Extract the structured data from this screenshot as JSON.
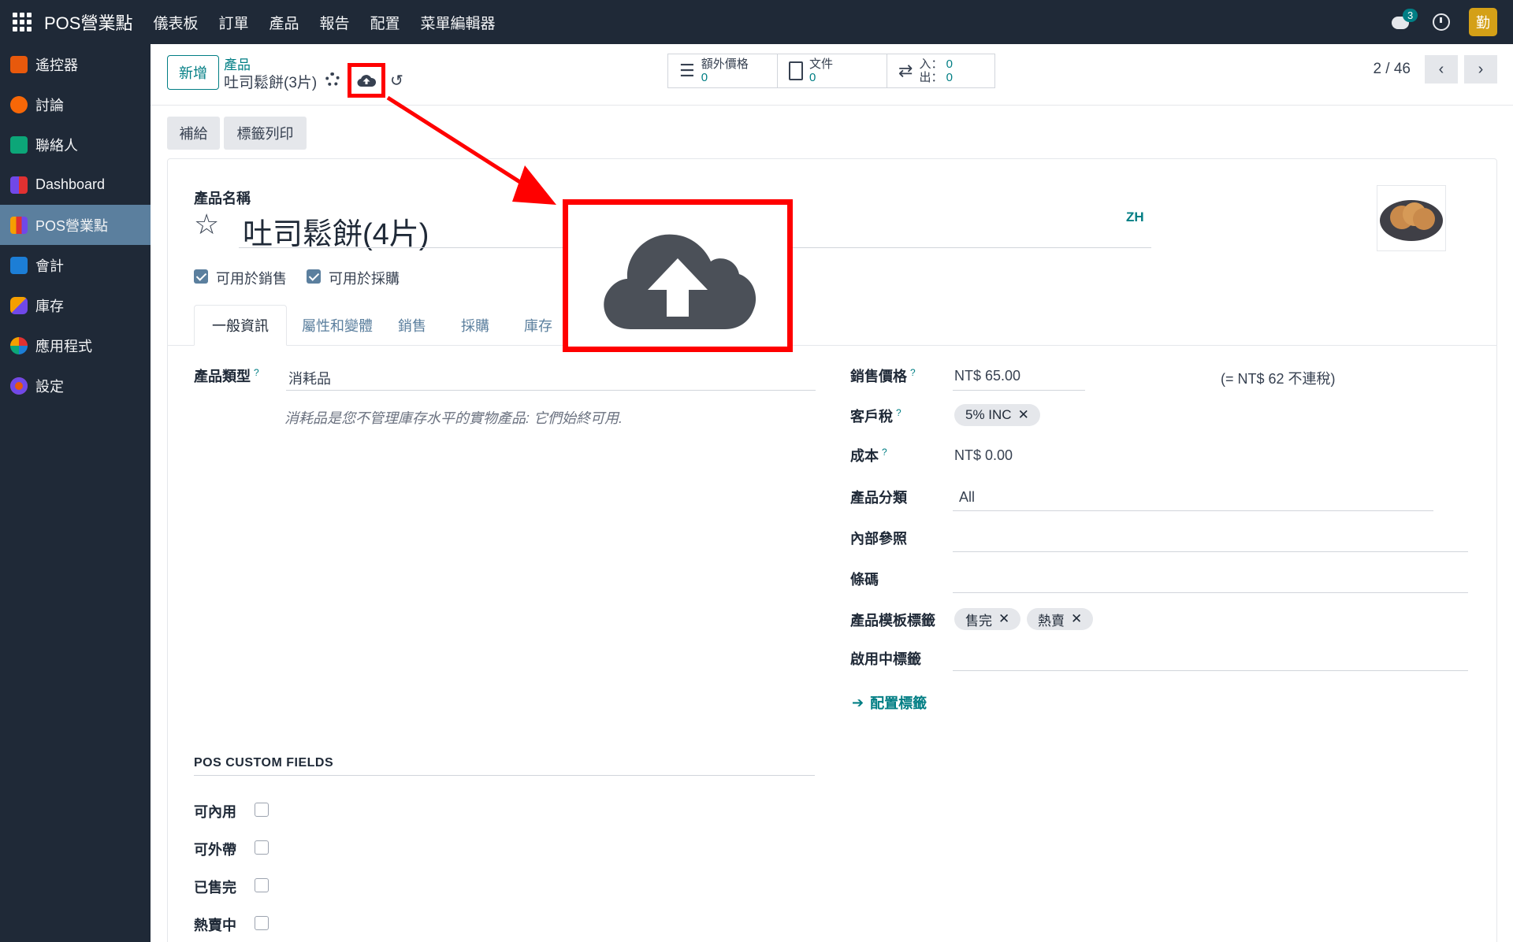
{
  "topbar": {
    "app_name": "POS營業點",
    "menu": [
      "儀表板",
      "訂單",
      "產品",
      "報告",
      "配置",
      "菜單編輯器"
    ],
    "chat_count": "3",
    "avatar_letter": "勤"
  },
  "sidebar": {
    "items": [
      {
        "label": "遙控器",
        "icon": "remote-icon",
        "color": "#e8590c"
      },
      {
        "label": "討論",
        "icon": "discuss-icon",
        "color": "#f76707"
      },
      {
        "label": "聯絡人",
        "icon": "contacts-icon",
        "color": "#0ca678"
      },
      {
        "label": "Dashboard",
        "icon": "dashboard-icon",
        "color": "#7048e8"
      },
      {
        "label": "POS營業點",
        "icon": "pos-icon",
        "color": "#e67700"
      },
      {
        "label": "會計",
        "icon": "accounting-icon",
        "color": "#1c7ed6"
      },
      {
        "label": "庫存",
        "icon": "inventory-icon",
        "color": "#e8590c"
      },
      {
        "label": "應用程式",
        "icon": "apps-icon",
        "color": "#e03131"
      },
      {
        "label": "設定",
        "icon": "settings-icon",
        "color": "#e8590c"
      }
    ],
    "active_index": 4
  },
  "control": {
    "new_label": "新增",
    "breadcrumb_parent": "產品",
    "breadcrumb_current": "吐司鬆餅(3片)",
    "smart_buttons": {
      "extra_price_label": "額外價格",
      "extra_price_value": "0",
      "documents_label": "文件",
      "documents_value": "0",
      "in_label": "入：",
      "in_value": "0",
      "out_label": "出：",
      "out_value": "0"
    },
    "pager": "2 / 46"
  },
  "actions": {
    "replenish": "補給",
    "print_labels": "標籤列印"
  },
  "form": {
    "product_name_label": "產品名稱",
    "product_name": "吐司鬆餅(4片)",
    "lang": "ZH",
    "can_be_sold": "可用於銷售",
    "can_be_purchased": "可用於採購",
    "tabs": [
      "一般資訊",
      "屬性和變體",
      "銷售",
      "採購",
      "庫存"
    ],
    "product_type_label": "產品類型",
    "product_type": "消耗品",
    "product_type_help": "消耗品是您不管理庫存水平的實物產品: 它們始終可用.",
    "sales_price_label": "銷售價格",
    "sales_price": "NT$ 65.00",
    "sales_price_note": "(= NT$ 62 不連稅)",
    "customer_tax_label": "客戶稅",
    "customer_tax_tag": "5% INC",
    "cost_label": "成本",
    "cost": "NT$ 0.00",
    "category_label": "產品分類",
    "category": "All",
    "internal_ref_label": "內部參照",
    "barcode_label": "條碼",
    "template_tags_label": "產品模板標籤",
    "template_tags": [
      "售完",
      "熱賣"
    ],
    "active_tags_label": "啟用中標籤",
    "configure_tags_link": "配置標籤",
    "pos_custom_fields_title": "POS CUSTOM FIELDS",
    "pos_fields": [
      "可內用",
      "可外帶",
      "已售完",
      "熱賣中"
    ]
  },
  "colors": {
    "primary": "#017e84",
    "navbar": "#1f2937",
    "annotation": "#ff0000"
  }
}
